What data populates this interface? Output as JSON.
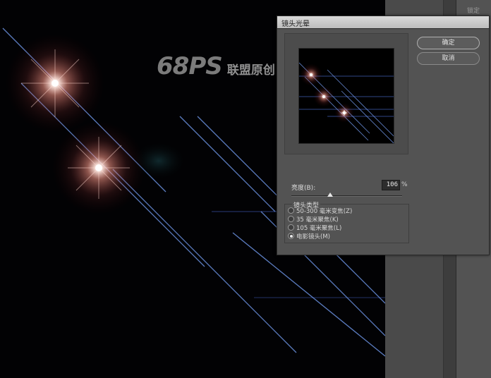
{
  "watermark": {
    "brand": "68PS",
    "subtitle": "联盟原创"
  },
  "right_panel": {
    "tab_label": "锁定"
  },
  "dialog": {
    "title": "镜头光晕",
    "ok_label": "确定",
    "cancel_label": "取消",
    "brightness_label": "亮度(B):",
    "brightness_value": "106",
    "brightness_unit": "%",
    "brightness_fraction": 0.35,
    "lens_type_title": "镜头类型",
    "lens_options": [
      {
        "label": "50-300 毫米变焦(Z)",
        "checked": false
      },
      {
        "label": "35 毫米聚焦(K)",
        "checked": false
      },
      {
        "label": "105 毫米聚焦(L)",
        "checked": false
      },
      {
        "label": "电影镜头(M)",
        "checked": true
      }
    ]
  },
  "colors": {
    "flare_core": "#ffffff",
    "flare_glow": "#ff9a8a",
    "streak": "#6f9bff",
    "dialog_bg": "#535353",
    "canvas_bg": "#020204"
  }
}
